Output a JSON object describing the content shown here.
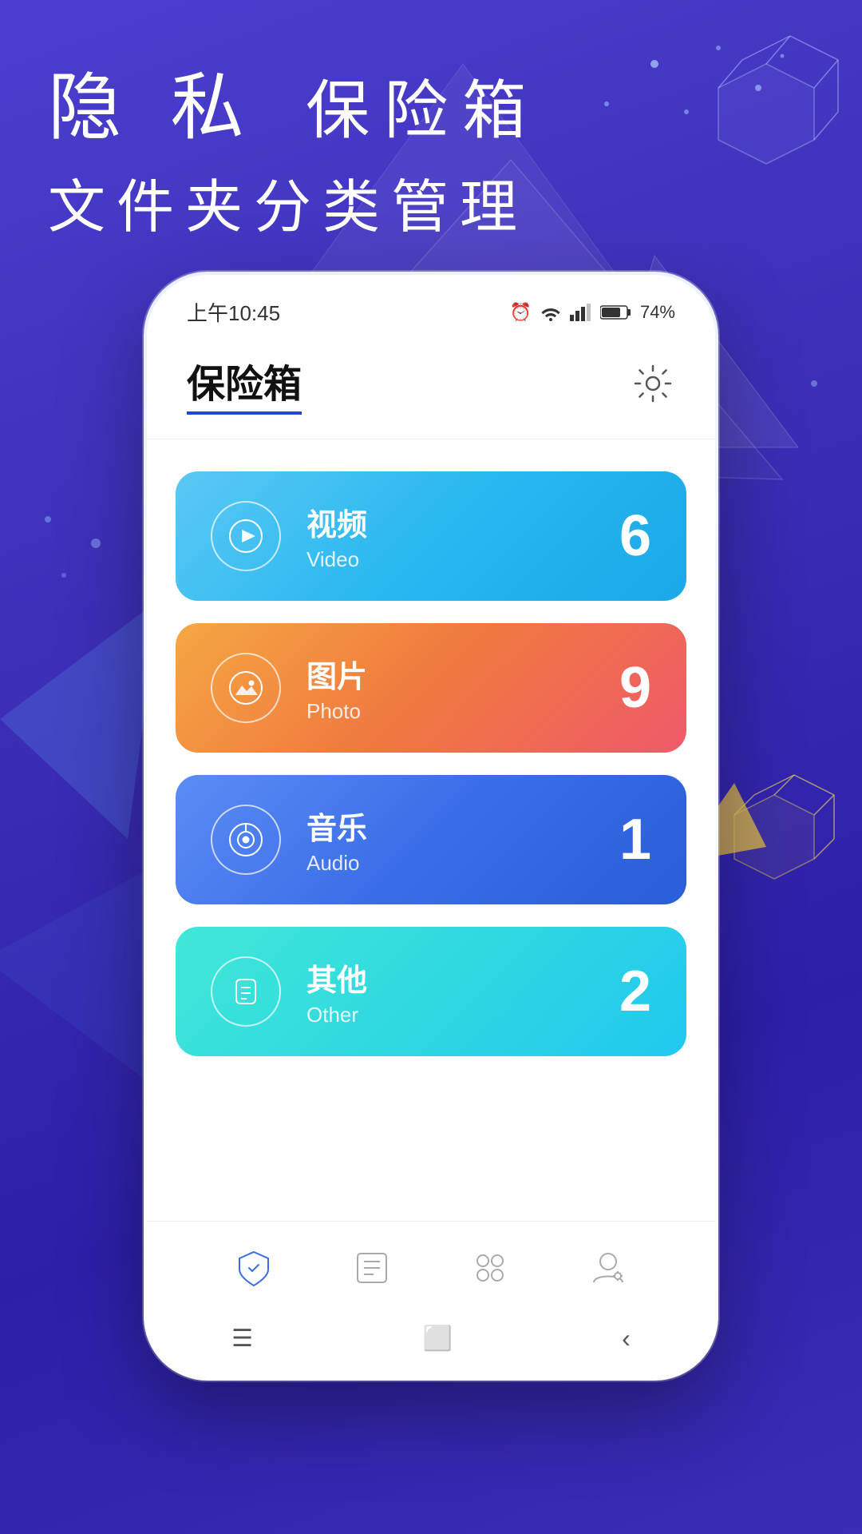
{
  "background": {
    "gradient_start": "#4a3fcf",
    "gradient_end": "#2d1fa8"
  },
  "header": {
    "line1_large": "隐 私",
    "line1_small": "保险箱",
    "line2": "文件夹分类管理"
  },
  "phone": {
    "status_bar": {
      "time": "上午10:45",
      "battery": "74%"
    },
    "app_title": "保险箱",
    "settings_label": "settings",
    "categories": [
      {
        "id": "video",
        "label_zh": "视频",
        "label_en": "Video",
        "count": "6",
        "gradient": "card-video"
      },
      {
        "id": "photo",
        "label_zh": "图片",
        "label_en": "Photo",
        "count": "9",
        "gradient": "card-photo"
      },
      {
        "id": "audio",
        "label_zh": "音乐",
        "label_en": "Audio",
        "count": "1",
        "gradient": "card-audio"
      },
      {
        "id": "other",
        "label_zh": "其他",
        "label_en": "Other",
        "count": "2",
        "gradient": "card-other"
      }
    ],
    "nav": {
      "items": [
        {
          "id": "safe",
          "label": "safe",
          "active": true
        },
        {
          "id": "list",
          "label": "list",
          "active": false
        },
        {
          "id": "apps",
          "label": "apps",
          "active": false
        },
        {
          "id": "profile",
          "label": "profile",
          "active": false
        }
      ]
    }
  }
}
